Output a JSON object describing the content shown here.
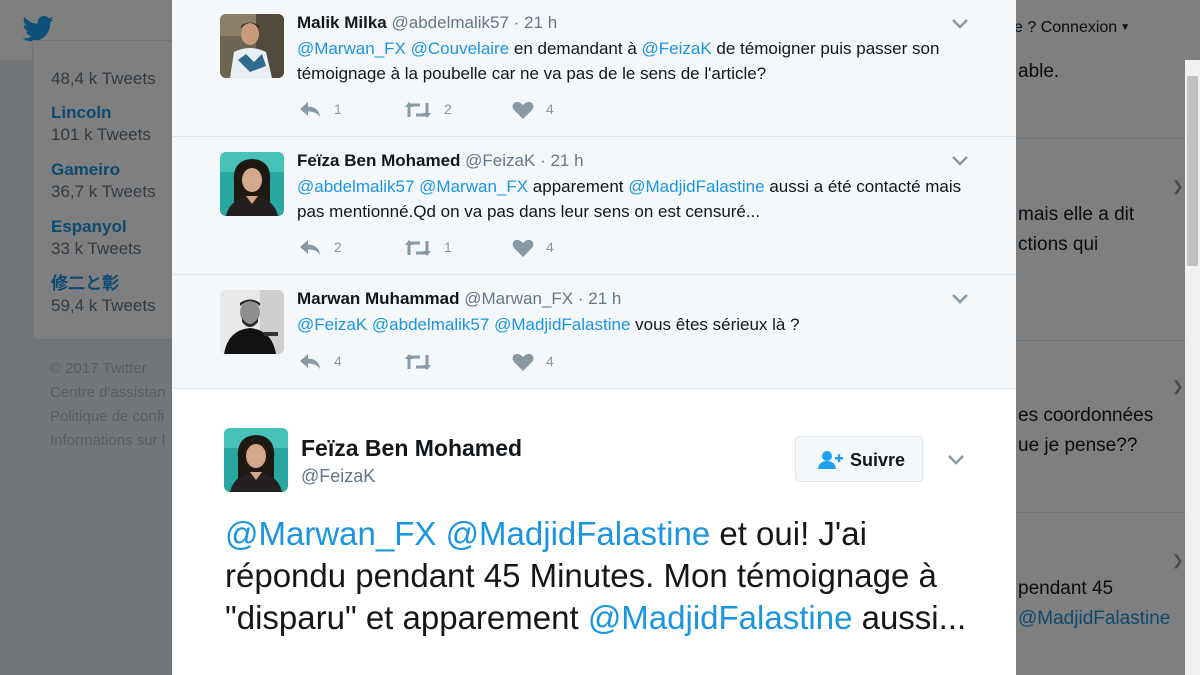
{
  "background": {
    "header": {
      "login_label": "e ? Connexion"
    },
    "trends": [
      {
        "name": "",
        "count": "48,4 k Tweets"
      },
      {
        "name": "Lincoln",
        "count": "101 k Tweets"
      },
      {
        "name": "Gameiro",
        "count": "36,7 k Tweets"
      },
      {
        "name": "Espanyol",
        "count": "33 k Tweets"
      },
      {
        "name": "修二と彰",
        "count": "59,4 k Tweets"
      }
    ],
    "footer": {
      "copyright": "© 2017 Twitter",
      "links": [
        "Centre d'assistan",
        "Politique de confi",
        "Informations sur l"
      ]
    },
    "right_snippets": [
      {
        "text": "able."
      },
      {
        "text": "mais elle a dit"
      },
      {
        "text": "ctions qui"
      },
      {
        "text": "es coordonnées"
      },
      {
        "text": "ue je pense??"
      },
      {
        "text": "pendant 45"
      },
      {
        "text": "@MadjidFalastine"
      }
    ]
  },
  "replies": [
    {
      "fullname": "Malik Milka",
      "handle": "@abdelmalik57",
      "dot": "·",
      "time": "21 h",
      "mentions": [
        "@Marwan_FX",
        "@Couvelaire"
      ],
      "text_a": " en demandant à ",
      "mention_mid": "@FeizaK",
      "text_b": " de témoigner puis passer son témoignage à la poubelle car ne va pas de le sens de l'article?",
      "replies_count": "1",
      "retweets_count": "2",
      "likes_count": "4"
    },
    {
      "fullname": "Feïza Ben Mohamed",
      "handle": "@FeizaK",
      "dot": "·",
      "time": "21 h",
      "mentions": [
        "@abdelmalik57",
        "@Marwan_FX"
      ],
      "text_a": " apparement ",
      "mention_mid": "@MadjidFalastine",
      "text_b": " aussi a été contacté mais pas mentionné.Qd on va pas dans leur sens on est censuré...",
      "replies_count": "2",
      "retweets_count": "1",
      "likes_count": "4"
    },
    {
      "fullname": "Marwan Muhammad",
      "handle": "@Marwan_FX",
      "dot": "·",
      "time": "21 h",
      "mentions": [
        "@FeizaK",
        "@abdelmalik57",
        "@MadjidFalastine"
      ],
      "text_b": " vous êtes sérieux là ?",
      "replies_count": "4",
      "retweets_count": "",
      "likes_count": "4"
    }
  ],
  "main_tweet": {
    "fullname": "Feïza Ben Mohamed",
    "handle": "@FeizaK",
    "follow_label": "Suivre",
    "mention1": "@Marwan_FX",
    "mention2": "@MadjidFalastine",
    "text_a": " et oui! J'ai répondu pendant 45 Minutes. Mon témoignage à \"disparu\" et apparement ",
    "mention3": "@MadjidFalastine",
    "text_b": " aussi..."
  },
  "colors": {
    "link_blue": "#1b95e0",
    "twitter_blue": "#1da1f2",
    "muted_gray": "#657786",
    "icon_gray": "#8899a6"
  },
  "icons": [
    "twitter-bird-icon",
    "reply-icon",
    "retweet-icon",
    "heart-icon",
    "chevron-down-icon",
    "follow-person-icon"
  ]
}
